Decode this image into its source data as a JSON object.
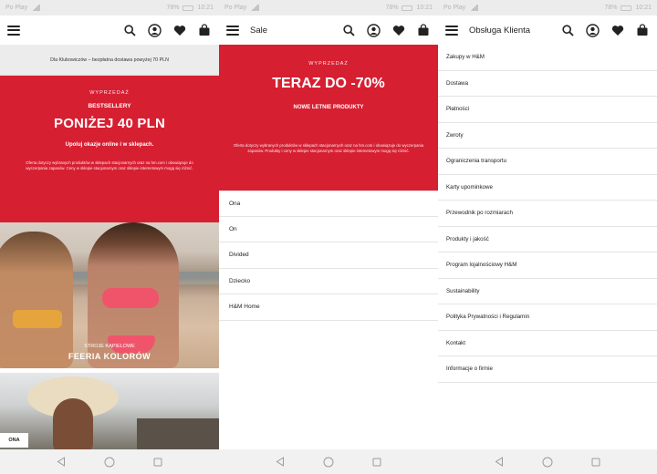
{
  "status_bar": {
    "left": "Po Play",
    "battery": "78%",
    "time": "10:21"
  },
  "screen1": {
    "club_banner": "Dla Klubowiczów – bezpłatna dostawa powyżej 70 PLN",
    "sale": {
      "kicker": "WYPRZEDAŻ",
      "subtitle": "BESTSELLERY",
      "headline": "PONIŻEJ 40 PLN",
      "cta": "Upoluj okazje online i w sklepach.",
      "fine_print": "Oferta dotyczy wybranych produktów w sklepach stacjonarnych oraz na hm.com i obowiązuje do wyczerpania zapasów. Ceny w sklepie stacjonarnym oraz sklepie internetowym mogą się różnić."
    },
    "photo_caption": {
      "kicker": "STROJE KĄPIELOWE",
      "title": "FEERIA KOLORÓW"
    },
    "ona_button": "ONA"
  },
  "screen2": {
    "header_title": "Sale",
    "sale": {
      "kicker": "WYPRZEDAŻ",
      "headline": "TERAZ DO -70%",
      "cta": "NOWE LETNIE PRODUKTY",
      "fine_print": "Oferta dotyczy wybranych produktów w sklepach stacjonarnych oraz na hm.com i obowiązuje do wyczerpania zapasów. Produkty i ceny w sklepie stacjonarnym oraz sklepie internetowym mogą się różnić."
    },
    "categories": [
      "Ona",
      "On",
      "Divided",
      "Dziecko",
      "H&M Home"
    ]
  },
  "screen3": {
    "header_title": "Obsługa Klienta",
    "items": [
      "Zakupy w H&M",
      "Dostawa",
      "Płatności",
      "Zwroty",
      "Ograniczenia transportu",
      "Karty upominkowe",
      "Przewodnik po rozmiarach",
      "Produkty i jakość",
      "Program lojalnościowy H&M",
      "Sustainability",
      "Polityka Prywatności i Regulamin",
      "Kontakt",
      "Informacje o firmie"
    ]
  },
  "colors": {
    "brand_red": "#d71f32",
    "nav_bg": "#f1f1f1",
    "banner_bg": "#ececec"
  },
  "icons": [
    "hamburger-icon",
    "search-icon",
    "account-icon",
    "heart-icon",
    "bag-icon",
    "back-icon",
    "home-icon",
    "recents-icon"
  ]
}
